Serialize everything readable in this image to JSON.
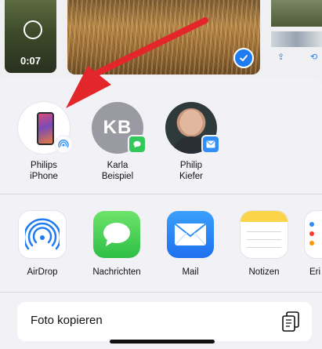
{
  "photos": {
    "video_duration": "0:07"
  },
  "contacts": [
    {
      "label_line1": "Philips",
      "label_line2": "iPhone"
    },
    {
      "initials": "KB",
      "label_line1": "Karla",
      "label_line2": "Beispiel"
    },
    {
      "label_line1": "Philip",
      "label_line2": "Kiefer"
    }
  ],
  "apps": [
    {
      "name": "AirDrop"
    },
    {
      "name": "Nachrichten"
    },
    {
      "name": "Mail"
    },
    {
      "name": "Notizen"
    },
    {
      "name": "Eri"
    }
  ],
  "actions": {
    "copy_photo": "Foto kopieren"
  },
  "colors": {
    "annotation_arrow": "#e3262a",
    "selection_blue": "#1f7cf0",
    "messages_green": "#34c759",
    "mail_blue": "#2f8ef7"
  }
}
